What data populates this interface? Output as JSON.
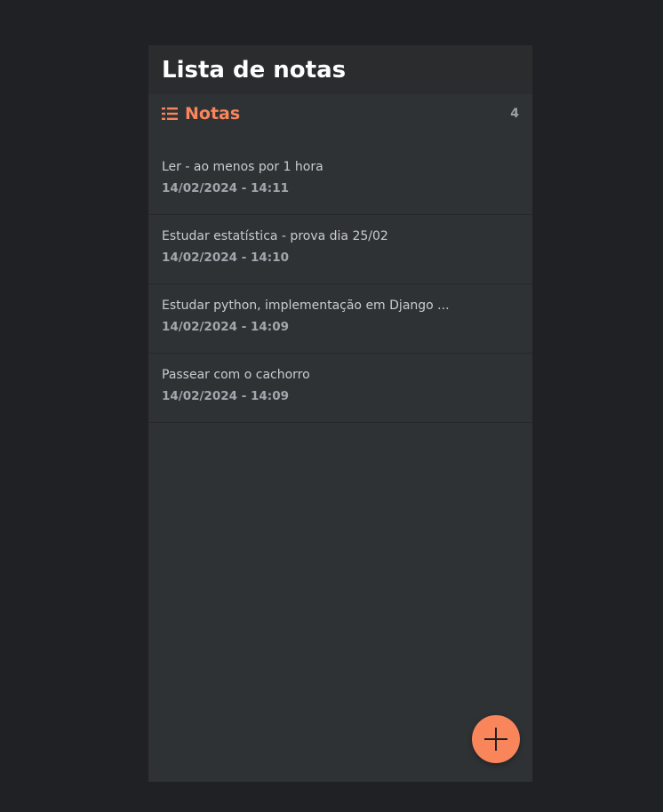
{
  "header": {
    "title": "Lista de notas"
  },
  "section": {
    "icon": "list-icon",
    "title": "Notas",
    "count": "4"
  },
  "notes": [
    {
      "text": "Ler - ao menos por 1 hora",
      "date": "14/02/2024 - 14:11"
    },
    {
      "text": "Estudar estatística - prova dia 25/02",
      "date": "14/02/2024 - 14:10"
    },
    {
      "text": "Estudar python, implementação em Django ...",
      "date": "14/02/2024 - 14:09"
    },
    {
      "text": "Passear com o cachorro",
      "date": "14/02/2024 - 14:09"
    }
  ],
  "fab": {
    "icon": "plus-icon"
  },
  "colors": {
    "background": "#202124",
    "panel": "#2f3235",
    "header": "#2a2c2e",
    "accent": "#f9855a"
  }
}
